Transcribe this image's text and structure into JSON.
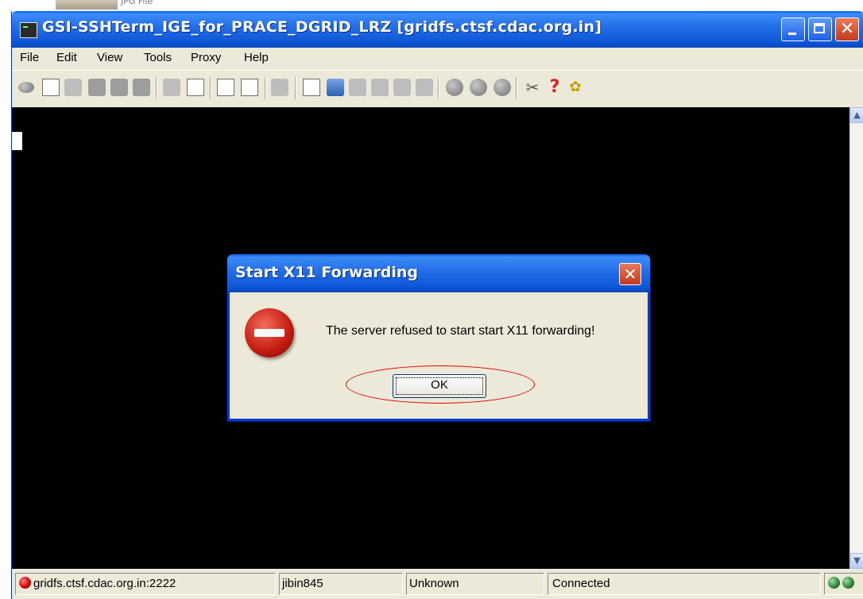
{
  "background": {
    "label": "JPG File"
  },
  "window": {
    "title": "GSI-SSHTerm_IGE_for_PRACE_DGRID_LRZ [gridfs.ctsf.cdac.org.in]",
    "controls": {
      "minimize": "minimize-icon",
      "maximize": "maximize-icon",
      "close": "close-icon"
    }
  },
  "menu": {
    "items": [
      {
        "label": "File"
      },
      {
        "label": "Edit"
      },
      {
        "label": "View"
      },
      {
        "label": "Tools"
      },
      {
        "label": "Proxy"
      },
      {
        "label": "Help"
      }
    ]
  },
  "toolbar": {
    "icons": [
      "connect-icon",
      "open-icon",
      "disconnect-icon",
      "save-icon",
      "print-icon",
      "save-output-icon",
      "connection-settings-icon",
      "properties-icon",
      "copy-icon",
      "paste-icon",
      "clear-screen-icon",
      "key-icon",
      "proxy-icon",
      "network-icon",
      "tunnel-icon",
      "record-icon",
      "playback-icon",
      "gray-circle-icon",
      "gray-circle-icon",
      "gray-circle-icon",
      "tools-icon",
      "help-icon",
      "grid-icon"
    ]
  },
  "terminal": {
    "background": "#000000",
    "cursor_color": "#ffffff"
  },
  "statusbar": {
    "host": "gridfs.ctsf.cdac.org.in:2222",
    "user": "jibin845",
    "state": "Unknown",
    "connection": "Connected",
    "host_led_color": "#cc0000",
    "status_led_color": "#2e7d32"
  },
  "dialog": {
    "title": "Start X11 Forwarding",
    "message": "The server refused to start start X11 forwarding!",
    "ok_label": "OK",
    "highlight_color": "#e00000"
  }
}
